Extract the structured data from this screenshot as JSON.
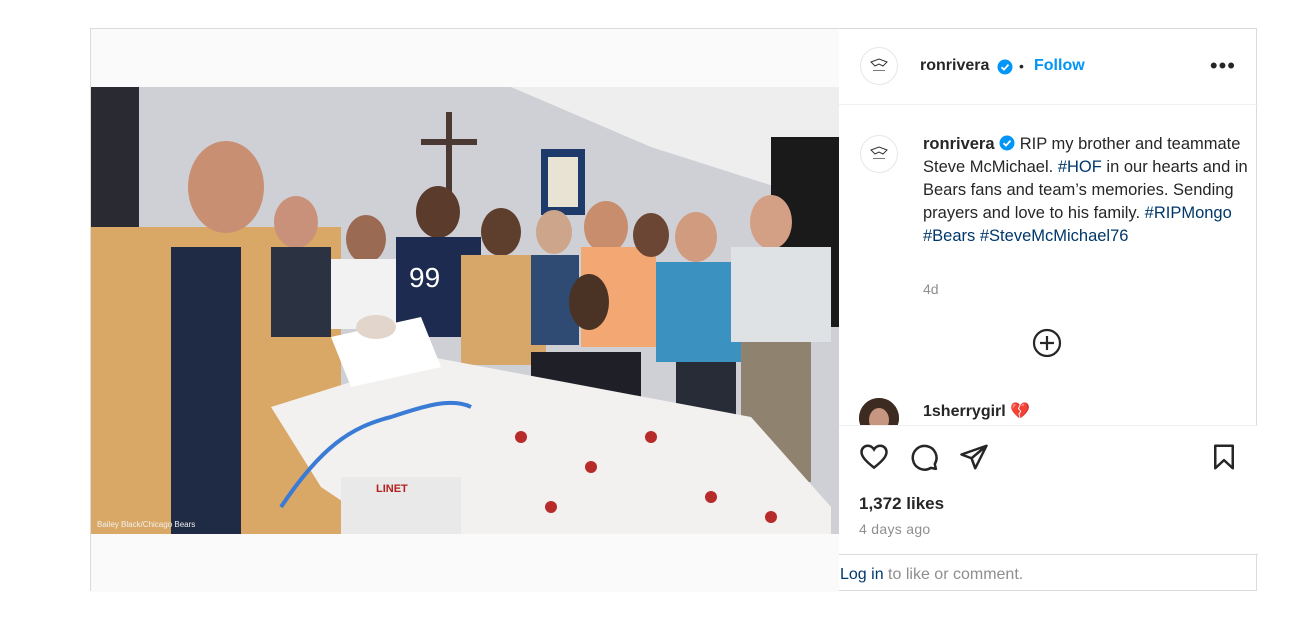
{
  "post": {
    "author": "ronrivera",
    "follow_label": "Follow",
    "separator": "•",
    "more_label": "•••",
    "photo_credit": "Bailey Black/Chicago Bears",
    "caption": {
      "author": "ronrivera",
      "text_1": "RIP my brother and teammate Steve McMichael.",
      "tag_hof": "#HOF",
      "text_2": "in our hearts and in Bears fans and team’s memories. Sending prayers and love to his family.",
      "tag_1": "#RIPMongo",
      "tag_2": "#Bears",
      "tag_3": "#SteveMcMichael76",
      "time": "4d"
    },
    "comment": {
      "author": "1sherrygirl",
      "emoji": "💔"
    },
    "likes": "1,372 likes",
    "posted": "4 days ago",
    "login": {
      "link": "Log in",
      "text": "to like or comment."
    },
    "colors": {
      "accent": "#0095f6",
      "link": "#00376b",
      "verified": "#0095f6",
      "heart": "#ed4956"
    },
    "icons": [
      "verified-icon",
      "more-options-icon",
      "add-comment-icon",
      "heart-icon",
      "comment-icon",
      "share-icon",
      "bookmark-icon"
    ]
  }
}
